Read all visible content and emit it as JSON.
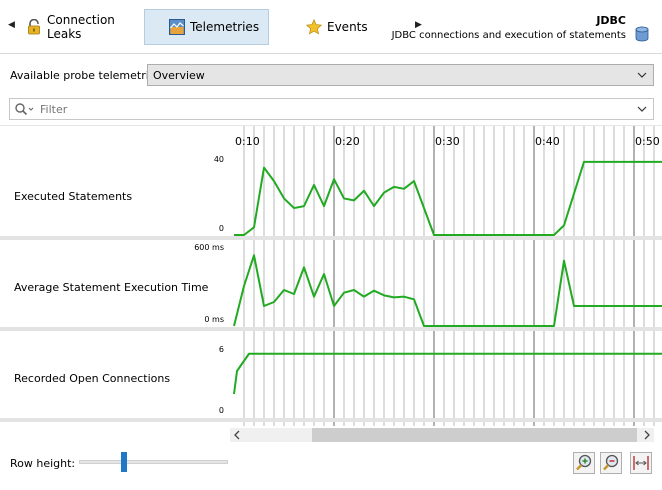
{
  "tabs": [
    {
      "label": "Connection Leaks",
      "icon": "lock-icon"
    },
    {
      "label": "Telemetries",
      "icon": "telemetry-chart-icon",
      "active": true
    },
    {
      "label": "Events",
      "icon": "star-icon"
    }
  ],
  "header": {
    "title": "JDBC",
    "subtitle": "JDBC connections and execution of statements"
  },
  "probe": {
    "label": "Available probe telemetries:",
    "selected": "Overview"
  },
  "filter": {
    "placeholder": "Filter"
  },
  "rows": [
    {
      "label": "Executed Statements"
    },
    {
      "label": "Average Statement Execution Time"
    },
    {
      "label": "Recorded Open Connections"
    }
  ],
  "bottom": {
    "row_height_label": "Row height:",
    "row_height_value": 0.3
  },
  "colors": {
    "series": "#22aa22",
    "active_tab_bg": "#dbe9f4",
    "slider": "#1f78c8"
  },
  "chart_data": [
    {
      "type": "line",
      "name": "Executed Statements",
      "x_ticks": [
        "0:10",
        "0:20",
        "0:30",
        "0:40",
        "0:50"
      ],
      "y_ticks": [
        "0",
        "40"
      ],
      "ylim": [
        0,
        40
      ],
      "x": [
        0,
        1,
        2,
        3,
        4,
        5,
        6,
        7,
        8,
        9,
        10,
        11,
        12,
        13,
        14,
        15,
        16,
        17,
        18,
        20,
        21,
        22,
        23,
        24,
        25,
        30,
        31,
        32,
        33,
        35,
        40,
        45,
        50,
        52
      ],
      "values": [
        0,
        0,
        4,
        35,
        28,
        19,
        14,
        15,
        26,
        15,
        29,
        19,
        18,
        23,
        15,
        22,
        25,
        24,
        28,
        0,
        0,
        0,
        0,
        0,
        0,
        0,
        0,
        0,
        5,
        38,
        38,
        38,
        38,
        38
      ]
    },
    {
      "type": "line",
      "name": "Average Statement Execution Time",
      "x_ticks": [
        "0:10",
        "0:20",
        "0:30",
        "0:40",
        "0:50"
      ],
      "y_ticks": [
        "0 ms",
        "600 ms"
      ],
      "ylim": [
        0,
        600
      ],
      "x": [
        0,
        1,
        2,
        3,
        4,
        5,
        6,
        7,
        8,
        9,
        10,
        11,
        12,
        13,
        14,
        15,
        16,
        17,
        18,
        19,
        20,
        24,
        30,
        31,
        32,
        33,
        34,
        35,
        40,
        45,
        50,
        52
      ],
      "values": [
        0,
        300,
        530,
        150,
        180,
        270,
        240,
        440,
        220,
        390,
        150,
        250,
        270,
        220,
        265,
        230,
        215,
        220,
        200,
        0,
        0,
        0,
        0,
        0,
        0,
        490,
        150,
        150,
        150,
        150,
        150,
        150
      ]
    },
    {
      "type": "line",
      "name": "Recorded Open Connections",
      "x_ticks": [
        "0:10",
        "0:20",
        "0:30",
        "0:40",
        "0:50"
      ],
      "y_ticks": [
        "0",
        "6"
      ],
      "ylim": [
        0,
        6
      ],
      "x": [
        0,
        0.3,
        1.5,
        10,
        20,
        30,
        40,
        50,
        52
      ],
      "values": [
        2,
        4,
        5.5,
        5.5,
        5.5,
        5.5,
        5.5,
        5.5,
        5.5
      ]
    }
  ]
}
